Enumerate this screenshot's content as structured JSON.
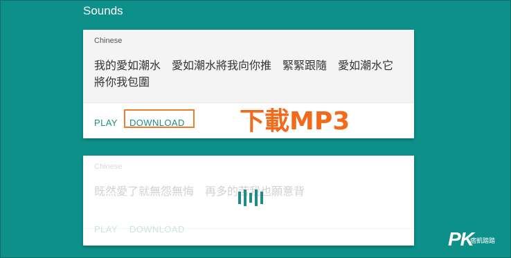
{
  "section": {
    "title": "Sounds"
  },
  "cards": [
    {
      "language": "Chinese",
      "text": "我的愛如潮水　愛如潮水將我向你推　緊緊跟隨　愛如潮水它將你我包圍",
      "play_label": "PLAY",
      "download_label": "DOWNLOAD"
    },
    {
      "language": "Chinese",
      "text": "既然愛了就無怨無悔　再多的苦我也願意背",
      "play_label": "PLAY",
      "download_label": "DOWNLOAD",
      "state": "loading"
    }
  ],
  "annotation": {
    "label": "下載MP3",
    "color": "#f36a1b",
    "highlight_color": "#f07c2b"
  },
  "watermark": {
    "logo": "PK",
    "subtitle": "痞凱踏踏"
  },
  "colors": {
    "background": "#0d9089",
    "accent": "#1d8d86"
  }
}
